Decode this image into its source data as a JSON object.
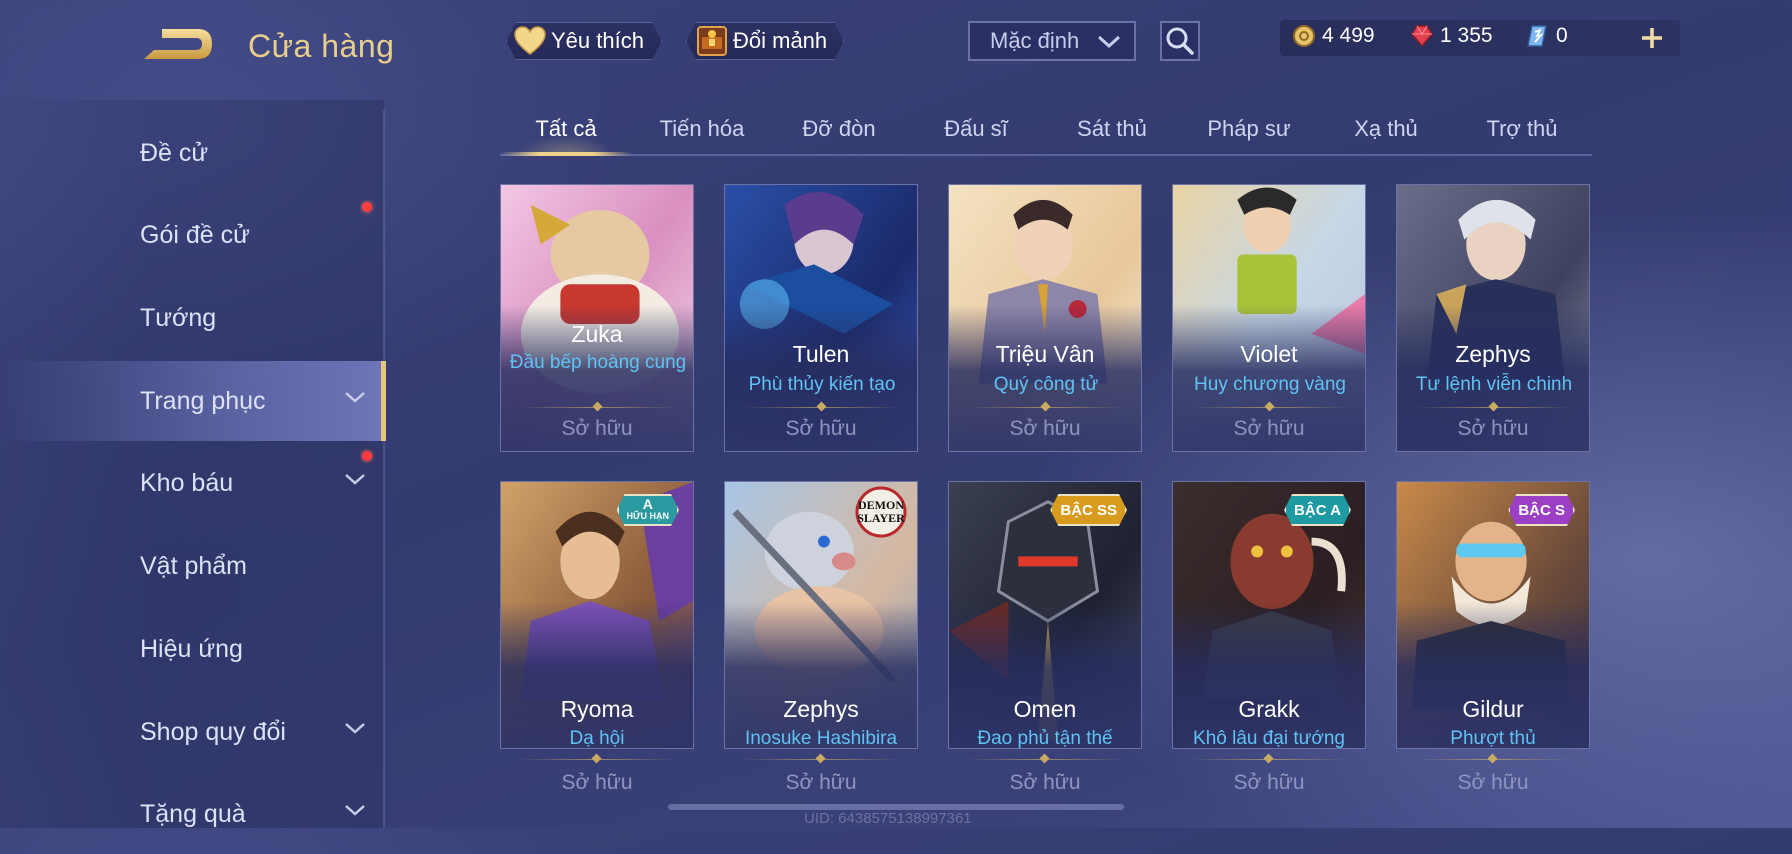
{
  "header": {
    "title": "Cửa hàng",
    "back_icon": "back-arrow-icon",
    "favorite_label": "Yêu thích",
    "fragment_label": "Đổi mảnh",
    "sort": {
      "selected": "Mặc định"
    },
    "currencies": [
      {
        "icon": "gold-coin-icon",
        "amount": "4 499",
        "color": "#e8c36a"
      },
      {
        "icon": "voucher-gem-icon",
        "amount": "1 355",
        "color": "#e2404e"
      },
      {
        "icon": "quan-huy-icon",
        "amount": "0",
        "color": "#7fb6f0"
      }
    ]
  },
  "sidebar": {
    "items": [
      {
        "label": "Đề cử",
        "chevron": false,
        "badge": false
      },
      {
        "label": "Gói đề cử",
        "chevron": false,
        "badge": true
      },
      {
        "label": "Tướng",
        "chevron": false,
        "badge": false
      },
      {
        "label": "Trang phục",
        "chevron": true,
        "badge": false,
        "active": true
      },
      {
        "label": "Kho báu",
        "chevron": true,
        "badge": true
      },
      {
        "label": "Vật phẩm",
        "chevron": false,
        "badge": false
      },
      {
        "label": "Hiệu ứng",
        "chevron": false,
        "badge": false
      },
      {
        "label": "Shop quy đổi",
        "chevron": true,
        "badge": false
      },
      {
        "label": "Tặng quà",
        "chevron": true,
        "badge": false
      }
    ]
  },
  "tabs": [
    {
      "label": "Tất cả",
      "active": true
    },
    {
      "label": "Tiến hóa"
    },
    {
      "label": "Đỡ đòn"
    },
    {
      "label": "Đấu sĩ"
    },
    {
      "label": "Sát thủ"
    },
    {
      "label": "Pháp sư"
    },
    {
      "label": "Xạ thủ"
    },
    {
      "label": "Trợ thủ"
    }
  ],
  "cards": [
    {
      "hero": "Zuka",
      "skin": "Đầu bếp hoàng cung",
      "status": "Sở hữu"
    },
    {
      "hero": "Tulen",
      "skin": "Phù thủy kiến tạo",
      "status": "Sở hữu"
    },
    {
      "hero": "Triệu Vân",
      "skin": "Quý công tử",
      "status": "Sở hữu"
    },
    {
      "hero": "Violet",
      "skin": "Huy chương vàng",
      "status": "Sở hữu"
    },
    {
      "hero": "Zephys",
      "skin": "Tư lệnh viễn chinh",
      "status": "Sở hữu"
    },
    {
      "hero": "Ryoma",
      "skin": "Dạ hội",
      "status": "Sở hữu",
      "badge": {
        "text": "A",
        "sub": "HỮU HẠN",
        "color": "#2a9aa0"
      }
    },
    {
      "hero": "Zephys",
      "skin": "Inosuke Hashibira",
      "status": "Sở hữu",
      "logo": "DEMON SLAYER"
    },
    {
      "hero": "Omen",
      "skin": "Đao phủ tận thế",
      "status": "Sở hữu",
      "badge": {
        "text": "BẬC SS",
        "color": "#d99b1e"
      }
    },
    {
      "hero": "Grakk",
      "skin": "Khô lâu đại tướng",
      "status": "Sở hữu",
      "badge": {
        "text": "BẬC A",
        "color": "#1f9aa3"
      }
    },
    {
      "hero": "Gildur",
      "skin": "Phượt thủ",
      "status": "Sở hữu",
      "badge": {
        "text": "BẬC S",
        "color": "#9b3fc4"
      }
    }
  ],
  "footer": {
    "uid": "UID: 6438575138997361"
  }
}
